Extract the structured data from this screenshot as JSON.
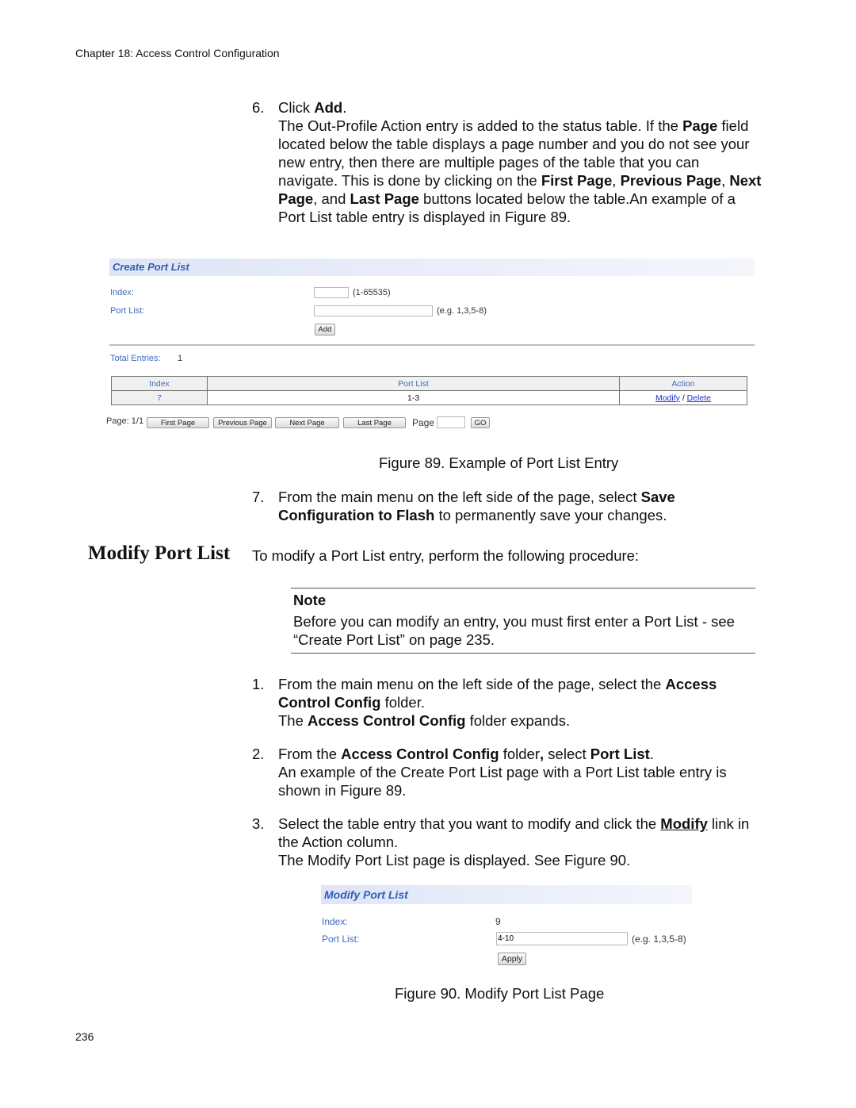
{
  "page": {
    "header": "Chapter 18: Access Control Configuration",
    "page_number": "236"
  },
  "step6": {
    "number": "6.",
    "line1_prefix": "Click ",
    "line1_bold": "Add",
    "line1_suffix": ".",
    "body": [
      {
        "t": "The Out-Profile Action entry is added to the status table. If the "
      },
      {
        "b": "Page"
      },
      {
        "t": " field located below the table displays a page number and you do not see your new entry, then there are multiple pages of the table that you can navigate. This is done by clicking on the "
      },
      {
        "b": "First Page"
      },
      {
        "t": ", "
      },
      {
        "b": "Previous Page"
      },
      {
        "t": ", "
      },
      {
        "b": "Next Page"
      },
      {
        "t": ", and "
      },
      {
        "b": "Last Page"
      },
      {
        "t": " buttons located below the table.An example of a Port List table entry is displayed in Figure 89."
      }
    ]
  },
  "figure89": {
    "panel_title": "Create Port List",
    "index_label": "Index:",
    "index_value": "",
    "index_hint": "(1-65535)",
    "portlist_label": "Port List:",
    "portlist_value": "",
    "portlist_hint": "(e.g. 1,3,5-8)",
    "add_button": "Add",
    "total_entries_label": "Total Entries:",
    "total_entries_value": "1",
    "table": {
      "headers": [
        "Index",
        "Port List",
        "Action"
      ],
      "rows": [
        {
          "index": "7",
          "port_list": "1-3",
          "modify": "Modify",
          "sep": "/",
          "delete": "Delete"
        }
      ]
    },
    "pagination": {
      "page_label": "Page: 1/1",
      "first": "First Page",
      "previous": "Previous Page",
      "next": "Next Page",
      "last": "Last Page",
      "page_input_label": "Page",
      "page_input_value": "",
      "go": "GO"
    },
    "caption": "Figure 89. Example of Port List Entry"
  },
  "step7": {
    "number": "7.",
    "body": [
      {
        "t": "From the main menu on the left side of the page, select "
      },
      {
        "b": "Save Configuration to Flash"
      },
      {
        "t": " to permanently save your changes."
      }
    ]
  },
  "section": {
    "heading": "Modify Port List",
    "intro": "To modify a Port List entry, perform the following procedure:"
  },
  "note": {
    "title": "Note",
    "text": "Before you can modify an entry, you must first enter a Port List - see “Create Port List” on page 235."
  },
  "steps": [
    {
      "number": "1.",
      "body": [
        {
          "t": "From the main menu on the left side of the page, select the "
        },
        {
          "b": "Access Control Config"
        },
        {
          "t": " folder."
        },
        {
          "br": true
        },
        {
          "t": "The "
        },
        {
          "b": "Access Control Config"
        },
        {
          "t": " folder expands."
        }
      ]
    },
    {
      "number": "2.",
      "body": [
        {
          "t": "From the "
        },
        {
          "b": "Access Control Config"
        },
        {
          "t": " folder"
        },
        {
          "b": ","
        },
        {
          "t": " select "
        },
        {
          "b": "Port List"
        },
        {
          "t": "."
        },
        {
          "br": true
        },
        {
          "t": "An example of the Create Port List page with a Port List table entry is shown in Figure 89."
        }
      ]
    },
    {
      "number": "3.",
      "body": [
        {
          "t": "Select the table entry that you want to modify and click the "
        },
        {
          "u": "Modify"
        },
        {
          "t": " link in the Action column."
        },
        {
          "br": true
        },
        {
          "t": "The Modify Port List page is displayed. See Figure 90."
        }
      ]
    }
  ],
  "figure90": {
    "panel_title": "Modify Port List",
    "index_label": "Index:",
    "index_value": "9",
    "portlist_label": "Port List:",
    "portlist_value": "4-10",
    "portlist_hint": "(e.g. 1,3,5-8)",
    "apply_button": "Apply",
    "caption": "Figure 90. Modify Port List Page"
  }
}
